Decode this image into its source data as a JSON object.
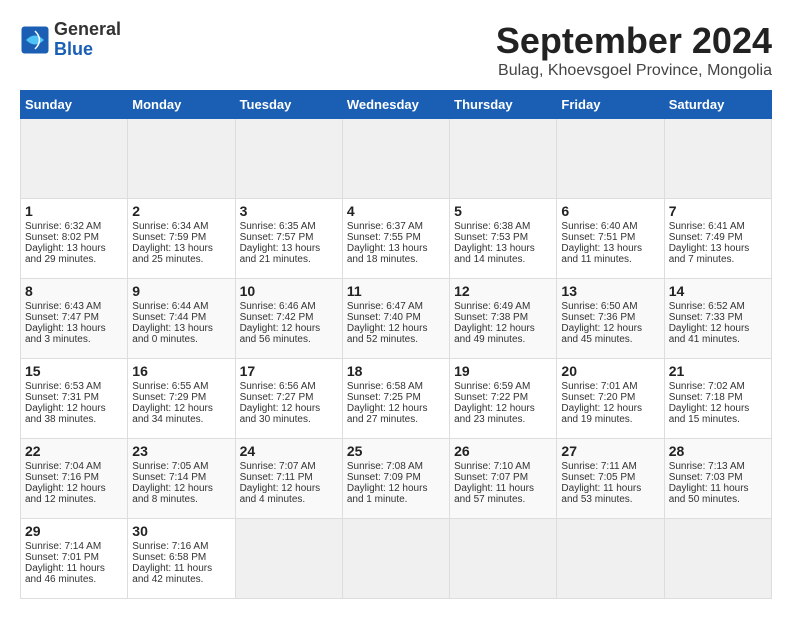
{
  "header": {
    "logo_general": "General",
    "logo_blue": "Blue",
    "month_title": "September 2024",
    "subtitle": "Bulag, Khoevsgoel Province, Mongolia"
  },
  "calendar": {
    "days_of_week": [
      "Sunday",
      "Monday",
      "Tuesday",
      "Wednesday",
      "Thursday",
      "Friday",
      "Saturday"
    ],
    "weeks": [
      [
        {
          "day": "",
          "empty": true
        },
        {
          "day": "",
          "empty": true
        },
        {
          "day": "",
          "empty": true
        },
        {
          "day": "",
          "empty": true
        },
        {
          "day": "",
          "empty": true
        },
        {
          "day": "",
          "empty": true
        },
        {
          "day": "",
          "empty": true
        }
      ],
      [
        {
          "day": "1",
          "sunrise": "Sunrise: 6:32 AM",
          "sunset": "Sunset: 8:02 PM",
          "daylight": "Daylight: 13 hours and 29 minutes."
        },
        {
          "day": "2",
          "sunrise": "Sunrise: 6:34 AM",
          "sunset": "Sunset: 7:59 PM",
          "daylight": "Daylight: 13 hours and 25 minutes."
        },
        {
          "day": "3",
          "sunrise": "Sunrise: 6:35 AM",
          "sunset": "Sunset: 7:57 PM",
          "daylight": "Daylight: 13 hours and 21 minutes."
        },
        {
          "day": "4",
          "sunrise": "Sunrise: 6:37 AM",
          "sunset": "Sunset: 7:55 PM",
          "daylight": "Daylight: 13 hours and 18 minutes."
        },
        {
          "day": "5",
          "sunrise": "Sunrise: 6:38 AM",
          "sunset": "Sunset: 7:53 PM",
          "daylight": "Daylight: 13 hours and 14 minutes."
        },
        {
          "day": "6",
          "sunrise": "Sunrise: 6:40 AM",
          "sunset": "Sunset: 7:51 PM",
          "daylight": "Daylight: 13 hours and 11 minutes."
        },
        {
          "day": "7",
          "sunrise": "Sunrise: 6:41 AM",
          "sunset": "Sunset: 7:49 PM",
          "daylight": "Daylight: 13 hours and 7 minutes."
        }
      ],
      [
        {
          "day": "8",
          "sunrise": "Sunrise: 6:43 AM",
          "sunset": "Sunset: 7:47 PM",
          "daylight": "Daylight: 13 hours and 3 minutes."
        },
        {
          "day": "9",
          "sunrise": "Sunrise: 6:44 AM",
          "sunset": "Sunset: 7:44 PM",
          "daylight": "Daylight: 13 hours and 0 minutes."
        },
        {
          "day": "10",
          "sunrise": "Sunrise: 6:46 AM",
          "sunset": "Sunset: 7:42 PM",
          "daylight": "Daylight: 12 hours and 56 minutes."
        },
        {
          "day": "11",
          "sunrise": "Sunrise: 6:47 AM",
          "sunset": "Sunset: 7:40 PM",
          "daylight": "Daylight: 12 hours and 52 minutes."
        },
        {
          "day": "12",
          "sunrise": "Sunrise: 6:49 AM",
          "sunset": "Sunset: 7:38 PM",
          "daylight": "Daylight: 12 hours and 49 minutes."
        },
        {
          "day": "13",
          "sunrise": "Sunrise: 6:50 AM",
          "sunset": "Sunset: 7:36 PM",
          "daylight": "Daylight: 12 hours and 45 minutes."
        },
        {
          "day": "14",
          "sunrise": "Sunrise: 6:52 AM",
          "sunset": "Sunset: 7:33 PM",
          "daylight": "Daylight: 12 hours and 41 minutes."
        }
      ],
      [
        {
          "day": "15",
          "sunrise": "Sunrise: 6:53 AM",
          "sunset": "Sunset: 7:31 PM",
          "daylight": "Daylight: 12 hours and 38 minutes."
        },
        {
          "day": "16",
          "sunrise": "Sunrise: 6:55 AM",
          "sunset": "Sunset: 7:29 PM",
          "daylight": "Daylight: 12 hours and 34 minutes."
        },
        {
          "day": "17",
          "sunrise": "Sunrise: 6:56 AM",
          "sunset": "Sunset: 7:27 PM",
          "daylight": "Daylight: 12 hours and 30 minutes."
        },
        {
          "day": "18",
          "sunrise": "Sunrise: 6:58 AM",
          "sunset": "Sunset: 7:25 PM",
          "daylight": "Daylight: 12 hours and 27 minutes."
        },
        {
          "day": "19",
          "sunrise": "Sunrise: 6:59 AM",
          "sunset": "Sunset: 7:22 PM",
          "daylight": "Daylight: 12 hours and 23 minutes."
        },
        {
          "day": "20",
          "sunrise": "Sunrise: 7:01 AM",
          "sunset": "Sunset: 7:20 PM",
          "daylight": "Daylight: 12 hours and 19 minutes."
        },
        {
          "day": "21",
          "sunrise": "Sunrise: 7:02 AM",
          "sunset": "Sunset: 7:18 PM",
          "daylight": "Daylight: 12 hours and 15 minutes."
        }
      ],
      [
        {
          "day": "22",
          "sunrise": "Sunrise: 7:04 AM",
          "sunset": "Sunset: 7:16 PM",
          "daylight": "Daylight: 12 hours and 12 minutes."
        },
        {
          "day": "23",
          "sunrise": "Sunrise: 7:05 AM",
          "sunset": "Sunset: 7:14 PM",
          "daylight": "Daylight: 12 hours and 8 minutes."
        },
        {
          "day": "24",
          "sunrise": "Sunrise: 7:07 AM",
          "sunset": "Sunset: 7:11 PM",
          "daylight": "Daylight: 12 hours and 4 minutes."
        },
        {
          "day": "25",
          "sunrise": "Sunrise: 7:08 AM",
          "sunset": "Sunset: 7:09 PM",
          "daylight": "Daylight: 12 hours and 1 minute."
        },
        {
          "day": "26",
          "sunrise": "Sunrise: 7:10 AM",
          "sunset": "Sunset: 7:07 PM",
          "daylight": "Daylight: 11 hours and 57 minutes."
        },
        {
          "day": "27",
          "sunrise": "Sunrise: 7:11 AM",
          "sunset": "Sunset: 7:05 PM",
          "daylight": "Daylight: 11 hours and 53 minutes."
        },
        {
          "day": "28",
          "sunrise": "Sunrise: 7:13 AM",
          "sunset": "Sunset: 7:03 PM",
          "daylight": "Daylight: 11 hours and 50 minutes."
        }
      ],
      [
        {
          "day": "29",
          "sunrise": "Sunrise: 7:14 AM",
          "sunset": "Sunset: 7:01 PM",
          "daylight": "Daylight: 11 hours and 46 minutes."
        },
        {
          "day": "30",
          "sunrise": "Sunrise: 7:16 AM",
          "sunset": "Sunset: 6:58 PM",
          "daylight": "Daylight: 11 hours and 42 minutes."
        },
        {
          "day": "",
          "empty": true
        },
        {
          "day": "",
          "empty": true
        },
        {
          "day": "",
          "empty": true
        },
        {
          "day": "",
          "empty": true
        },
        {
          "day": "",
          "empty": true
        }
      ]
    ]
  }
}
